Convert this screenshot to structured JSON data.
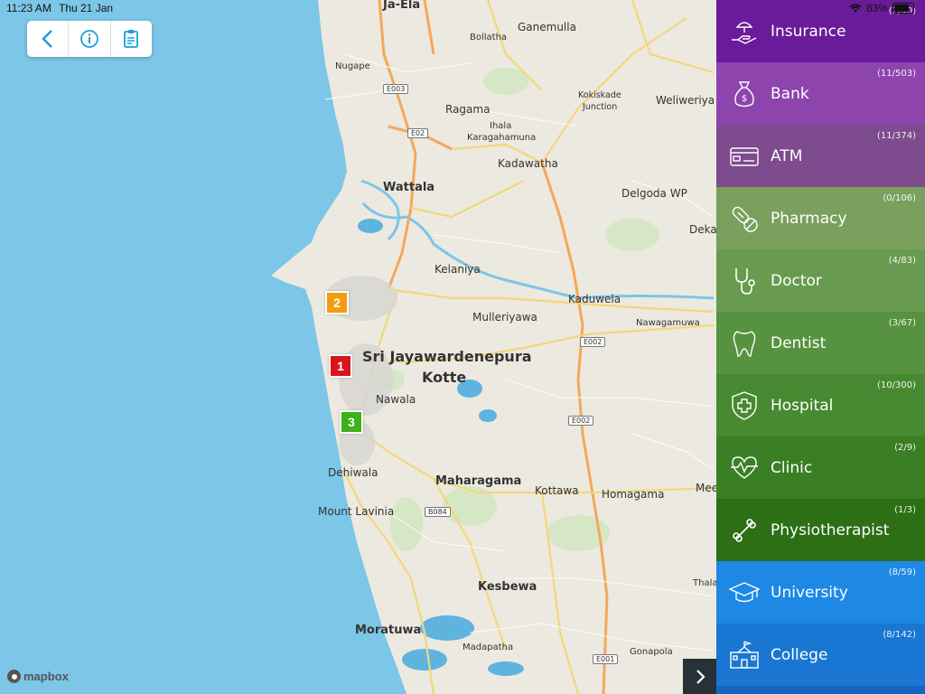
{
  "status": {
    "time": "11:23 AM",
    "date": "Thu 21 Jan",
    "battery": "83%"
  },
  "toolbar": {
    "back_icon": "chevron-left-icon",
    "info_icon": "info-icon",
    "report_icon": "clipboard-icon"
  },
  "map": {
    "attribution": "mapbox",
    "labels": {
      "ja_ela": "Ja-Ela",
      "ganemulla": "Ganemulla",
      "bollatha": "Bollatha",
      "nugape": "Nugape",
      "kokiskade": "Kokiskade",
      "junction": "Junction",
      "weliweriya": "Weliweriya",
      "ragama": "Ragama",
      "ihala": "Ihala",
      "karagahamuna": "Karagahamuna",
      "kadawatha": "Kadawatha",
      "wattala": "Wattala",
      "delgoda": "Delgoda WP",
      "deka": "Deka",
      "kelaniya": "Kelaniya",
      "kaduwela": "Kaduwela",
      "mulleriyawa": "Mulleriyawa",
      "nawagamuwa": "Nawagamuwa",
      "sjk1": "Sri Jayawardenepura",
      "sjk2": "Kotte",
      "nawala": "Nawala",
      "dehiwala": "Dehiwala",
      "maharagama": "Maharagama",
      "kottawa": "Kottawa",
      "homagama": "Homagama",
      "mee": "Mee",
      "mount_lavinia": "Mount Lavinia",
      "kesbewa": "Kesbewa",
      "thala": "Thala",
      "moratuwa": "Moratuwa",
      "madapatha": "Madapatha",
      "gonapola": "Gonapola"
    },
    "roads": {
      "e003": "E003",
      "e02": "E02",
      "e002a": "E002",
      "e002b": "E002",
      "b084": "B084",
      "e001": "E001"
    },
    "markers": [
      {
        "n": "1",
        "color": "#d9141c"
      },
      {
        "n": "2",
        "color": "#f39c12"
      },
      {
        "n": "3",
        "color": "#3cb119"
      }
    ]
  },
  "sidebar": [
    {
      "label": "Insurance",
      "count": "(2/40)",
      "color": "#6a1b9a",
      "icon": "insurance-hand-icon"
    },
    {
      "label": "Bank",
      "count": "(11/503)",
      "color": "#8e44ad",
      "icon": "money-bag-icon"
    },
    {
      "label": "ATM",
      "count": "(11/374)",
      "color": "#7d4b8e",
      "icon": "atm-card-icon"
    },
    {
      "label": "Pharmacy",
      "count": "(0/106)",
      "color": "#7aa05e",
      "icon": "pill-icon"
    },
    {
      "label": "Doctor",
      "count": "(4/83)",
      "color": "#689b4f",
      "icon": "stethoscope-icon"
    },
    {
      "label": "Dentist",
      "count": "(3/67)",
      "color": "#56923f",
      "icon": "tooth-icon"
    },
    {
      "label": "Hospital",
      "count": "(10/300)",
      "color": "#478a31",
      "icon": "hospital-shield-icon"
    },
    {
      "label": "Clinic",
      "count": "(2/9)",
      "color": "#3a7f24",
      "icon": "heartbeat-icon"
    },
    {
      "label": "Physiotherapist",
      "count": "(1/3)",
      "color": "#2c6f15",
      "icon": "bone-icon"
    },
    {
      "label": "University",
      "count": "(8/59)",
      "color": "#1e88e5",
      "icon": "graduation-cap-icon"
    },
    {
      "label": "College",
      "count": "(8/142)",
      "color": "#1976d2",
      "icon": "school-building-icon"
    }
  ],
  "colors": {
    "land": "#ece9e0",
    "sea": "#7cc6e8",
    "lake": "#5fb3df",
    "major_road": "#f7b96b",
    "minor_road": "#f3d77a",
    "park": "#cfe3b8"
  }
}
